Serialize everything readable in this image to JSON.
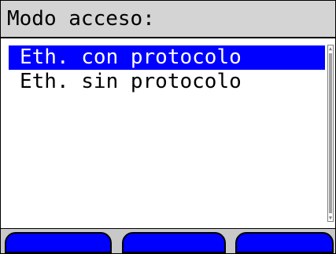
{
  "header": {
    "title": "Modo acceso:"
  },
  "menu": {
    "items": [
      {
        "label": "Eth. con protocolo",
        "selected": true
      },
      {
        "label": "Eth. sin protocolo",
        "selected": false
      }
    ]
  },
  "softkeys": [
    {
      "label": ""
    },
    {
      "label": ""
    },
    {
      "label": ""
    }
  ],
  "colors": {
    "selection": "#0000ff",
    "softkey": "#0000ff",
    "header_bg": "#d4d4d4"
  }
}
